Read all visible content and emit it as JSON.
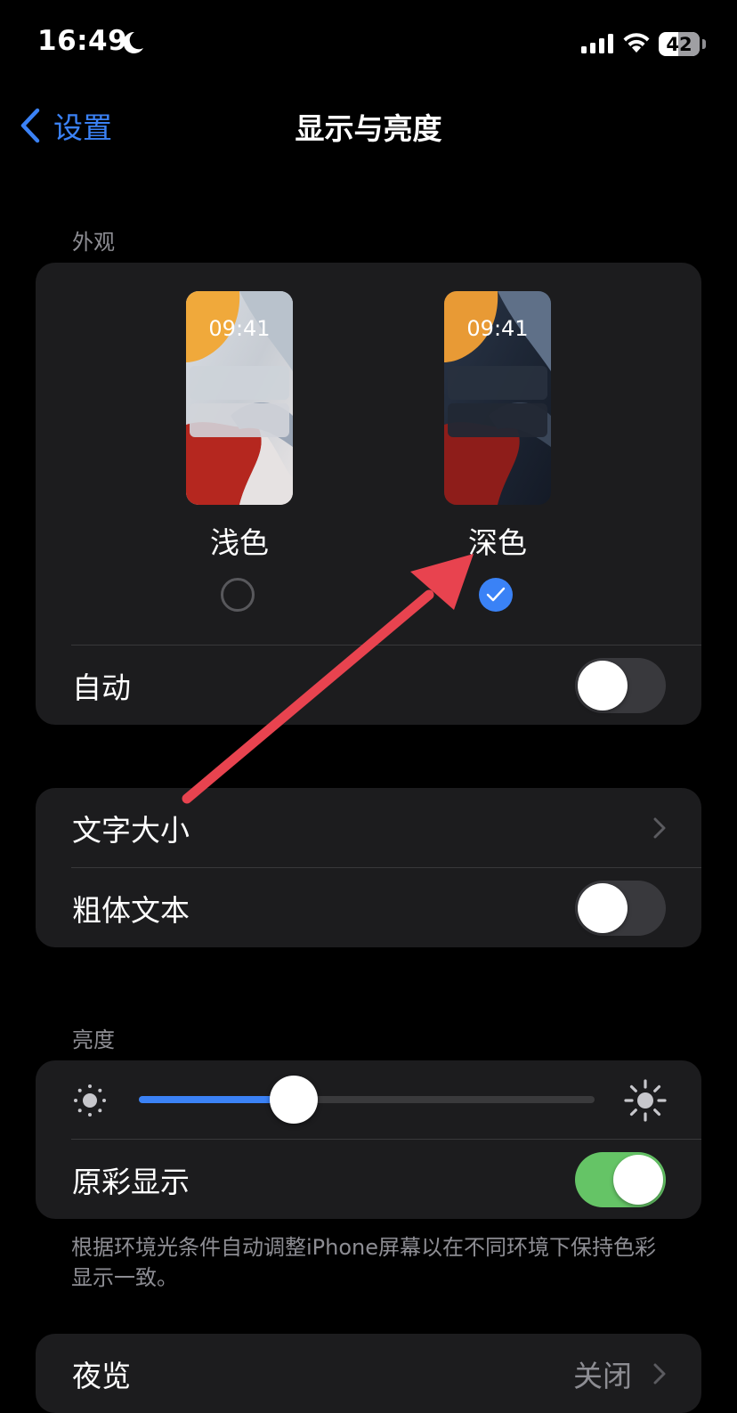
{
  "status_bar": {
    "time": "16:49",
    "battery": "42"
  },
  "nav": {
    "back_label": "设置",
    "title": "显示与亮度"
  },
  "appearance": {
    "header": "外观",
    "options": [
      {
        "label": "浅色",
        "preview_time": "09:41",
        "selected": false
      },
      {
        "label": "深色",
        "preview_time": "09:41",
        "selected": true
      }
    ],
    "auto_label": "自动",
    "auto_on": false
  },
  "text_group": {
    "text_size_label": "文字大小",
    "bold_text_label": "粗体文本",
    "bold_text_on": false
  },
  "brightness": {
    "header": "亮度",
    "level": 0.34,
    "true_tone_label": "原彩显示",
    "true_tone_on": true,
    "footer": "根据环境光条件自动调整iPhone屏幕以在不同环境下保持色彩显示一致。"
  },
  "night_shift": {
    "label": "夜览",
    "value": "关闭"
  },
  "colors": {
    "accent": "#3b82f6",
    "toggle_on": "#65c466",
    "annotation_arrow": "#e8434f"
  }
}
